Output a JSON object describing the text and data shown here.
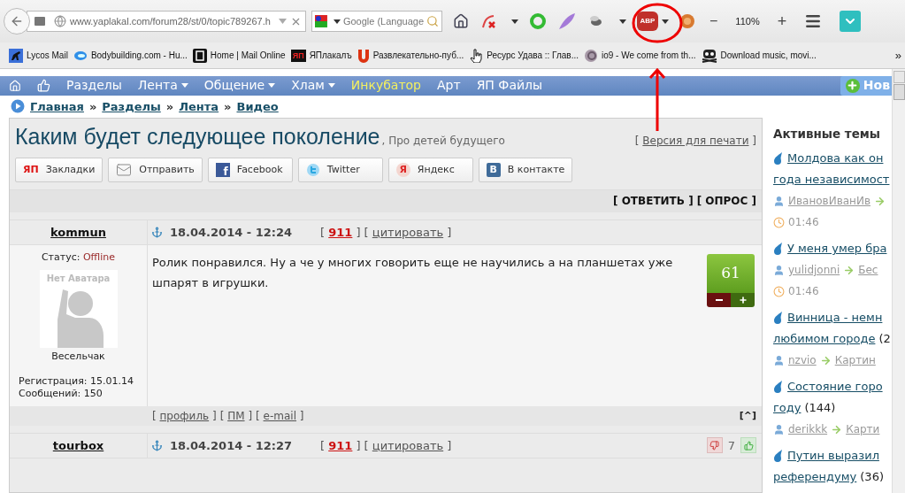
{
  "browser": {
    "url": "www.yaplakal.com/forum28/st/0/topic789267.h",
    "search_placeholder": "Google (Language",
    "adblock_label": "ABP",
    "zoom": "110%",
    "zoom_out": "−",
    "zoom_in": "+",
    "bookmarks": [
      {
        "kind": "dog",
        "label": "Lycos Mail"
      },
      {
        "kind": "swirl",
        "label": "Bodybuilding.com - Hu..."
      },
      {
        "kind": "dark",
        "label": "Home | Mail Online"
      },
      {
        "kind": "badge",
        "badge": "ЯП",
        "label": "ЯПлакалъ"
      },
      {
        "kind": "horseshoe",
        "label": "Развлекательно-пуб..."
      },
      {
        "kind": "hand",
        "label": "Ресурс Удава :: Глав..."
      },
      {
        "kind": "spiral",
        "label": "io9 - We come from th..."
      },
      {
        "kind": "skull",
        "label": "Download music, movi..."
      }
    ],
    "bookmarks_more": "»"
  },
  "nav": {
    "items": [
      {
        "label": "Разделы",
        "dropdown": false,
        "highlight": false
      },
      {
        "label": "Лента",
        "dropdown": true,
        "highlight": false
      },
      {
        "label": "Общение",
        "dropdown": true,
        "highlight": false
      },
      {
        "label": "Хлам",
        "dropdown": true,
        "highlight": false
      },
      {
        "label": "Инкубатор",
        "dropdown": false,
        "highlight": true
      },
      {
        "label": "Арт",
        "dropdown": false,
        "highlight": false
      },
      {
        "label": "ЯП Файлы",
        "dropdown": false,
        "highlight": false
      }
    ],
    "new_button": "Нов"
  },
  "breadcrumb": {
    "items": [
      "Главная",
      "Разделы",
      "Лента",
      "Видео"
    ],
    "separator": "»"
  },
  "topic": {
    "title": "Каким будет следующее поколение",
    "subtitle": ", Про детей будущего",
    "print": {
      "prefix": "[",
      "text": "Версия для печати",
      "suffix": "]"
    },
    "share": [
      {
        "kind": "yp",
        "icon_text": "ЯП",
        "label": "Закладки"
      },
      {
        "kind": "mail",
        "label": "Отправить"
      },
      {
        "kind": "facebook",
        "icon_text": "f",
        "label": "Facebook"
      },
      {
        "kind": "twitter",
        "label": "Twitter"
      },
      {
        "kind": "yandex",
        "icon_text": "Я",
        "label": "Яндекс"
      },
      {
        "kind": "vk",
        "icon_text": "В",
        "label": "В контакте"
      }
    ],
    "actions": [
      "[ ОТВЕТИТЬ ]",
      "[ ОПРОС ]"
    ]
  },
  "posts": [
    {
      "author": "kommun",
      "date": "18.04.2014 - 12:24",
      "links": [
        {
          "prefix": "[",
          "text": "911",
          "suffix": "]",
          "kind": "count"
        },
        {
          "prefix": "[",
          "text": "цитировать",
          "suffix": "]",
          "kind": "plain"
        }
      ],
      "status_label": "Статус:",
      "status": "Offline",
      "avatar_text": "Нет Аватара",
      "rank": "Весельчак",
      "registration": "Регистрация: 15.01.14",
      "messages": "Сообщений: 150",
      "body": "Ролик понравился. Ну а че у многих говорить еще не научились а на планшетах уже шпарят в игрушки.",
      "rating": {
        "kind": "box",
        "value": "61"
      },
      "footer": [
        {
          "prefix": "[",
          "text": "профиль",
          "suffix": "]"
        },
        {
          "prefix": "[",
          "text": "ПМ",
          "suffix": "]"
        },
        {
          "prefix": "[",
          "text": "e-mail",
          "suffix": "]"
        }
      ],
      "top": "[^]"
    },
    {
      "author": "tourbox",
      "date": "18.04.2014 - 12:27",
      "links": [
        {
          "prefix": "[",
          "text": "911",
          "suffix": "]",
          "kind": "count"
        },
        {
          "prefix": "[",
          "text": "цитировать",
          "suffix": "]",
          "kind": "plain"
        }
      ],
      "rating": {
        "kind": "thumbs",
        "value": "7"
      }
    }
  ],
  "sidebar": {
    "title": "Активные темы",
    "topics": [
      {
        "lines": [
          "Молдова как он",
          "года независимост"
        ],
        "author": "ИвановИванИв",
        "time": "01:46"
      },
      {
        "lines": [
          "У меня умер бра"
        ],
        "author": "yulidjonni",
        "section": "Бес",
        "time": "01:46"
      },
      {
        "lines": [
          "Винница - немн",
          "любимом городе"
        ],
        "count": "(2",
        "author": "nzvio",
        "section": "Картин"
      },
      {
        "lines": [
          "Состояние горо",
          "году"
        ],
        "count": "(144)",
        "author": "derikkk",
        "section": "Карти"
      },
      {
        "lines": [
          "Путин выразил",
          "референдуму"
        ],
        "count": "(36)"
      }
    ]
  }
}
